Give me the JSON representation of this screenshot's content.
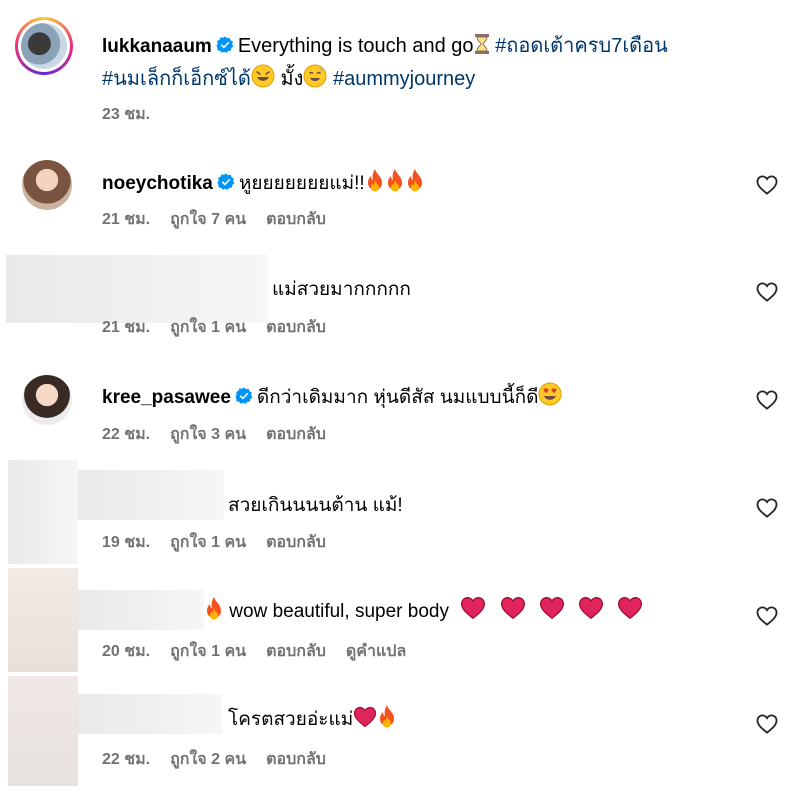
{
  "post": {
    "username": "lukkanaaum",
    "caption_text": "Everything is touch and go",
    "caption_tag1": "#ถอดเต้าครบ7เดือน",
    "caption_tag2": "#นมเล็กก็เอ็กซ์ได้",
    "caption_mid": "มั้ง",
    "caption_tag3": "#aummyjourney",
    "time": "23 ชม."
  },
  "comments": [
    {
      "username": "noeychotika",
      "verified": true,
      "text": "หูยยยยยยยแม่!!",
      "time": "21 ชม.",
      "likes": "ถูกใจ 7 คน",
      "reply": "ตอบกลับ"
    },
    {
      "username": "",
      "verified": false,
      "text": "แม่สวยมากกกกก",
      "time": "21 ชม.",
      "likes": "ถูกใจ 1 คน",
      "reply": "ตอบกลับ"
    },
    {
      "username": "kree_pasawee",
      "verified": true,
      "text": "ดีกว่าเดิมมาก หุ่นดีสัส นมแบบนี้ก็ดี",
      "time": "22 ชม.",
      "likes": "ถูกใจ 3 คน",
      "reply": "ตอบกลับ"
    },
    {
      "username": "",
      "verified": false,
      "text": "สวยเกินนนนต้าน แม้!",
      "time": "19 ชม.",
      "likes": "ถูกใจ 1 คน",
      "reply": "ตอบกลับ"
    },
    {
      "username": "",
      "verified": false,
      "text": "wow beautiful, super body",
      "time": "20 ชม.",
      "likes": "ถูกใจ 1 คน",
      "reply": "ตอบกลับ",
      "translate": "ดูคำแปล"
    },
    {
      "username": "",
      "verified": false,
      "text": "โครตสวยอ่ะแม่",
      "time": "22 ชม.",
      "likes": "ถูกใจ 2 คน",
      "reply": "ตอบกลับ"
    }
  ],
  "icons": {
    "verified": "verified-badge-icon",
    "heart": "heart-outline-icon",
    "fire": "fire-emoji",
    "red_heart": "red-heart-emoji"
  },
  "colors": {
    "verified": "#0095f6",
    "hashtag": "#00376b",
    "meta": "#737373"
  }
}
